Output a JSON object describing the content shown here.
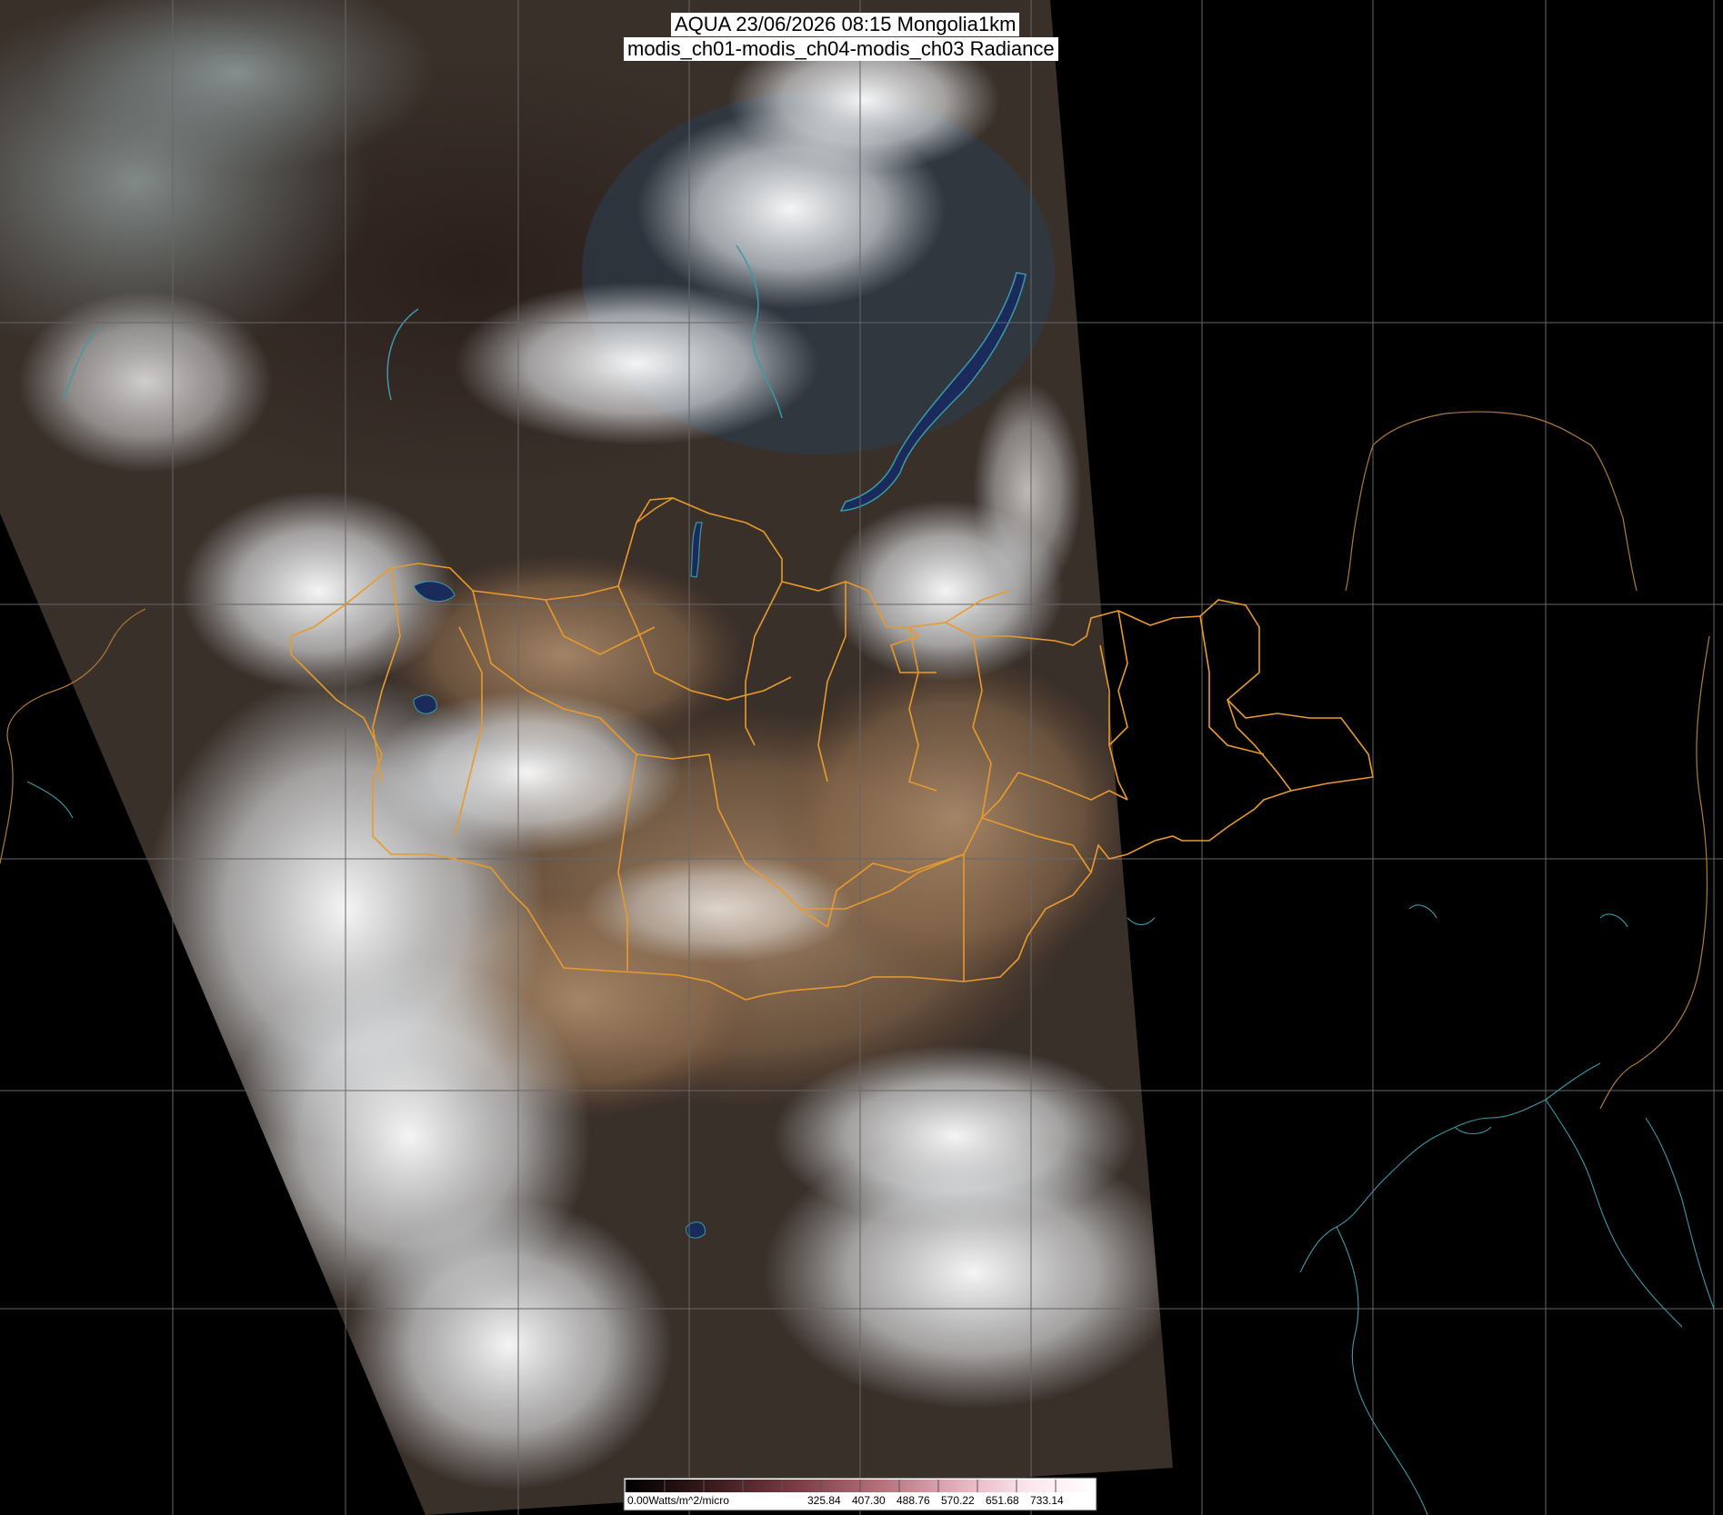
{
  "title": {
    "line1": "AQUA 23/06/2026 08:15 Mongolia1km",
    "line2": "modis_ch01-modis_ch04-modis_ch03 Radiance"
  },
  "legend": {
    "unit_label": "0.00Watts/m^2/micro",
    "ticks": [
      "325.84",
      "407.30",
      "488.76",
      "570.22",
      "651.68",
      "733.14"
    ],
    "gradient_colors": [
      "#000000",
      "#3a1a1c",
      "#7a3a44",
      "#b8727e",
      "#e6b4c0",
      "#fbe6ee",
      "#ffffff"
    ]
  },
  "colors": {
    "background": "#000000",
    "graticule": "#666666",
    "mongolia_borders": "#e89a2c",
    "coastline": "#3a9aa8",
    "country_border_east": "#b07a3a",
    "clouds": "#f2f4f6",
    "desert": "#9a7a5a",
    "forest": "#2e2420",
    "lake": "#1a2a5a"
  }
}
